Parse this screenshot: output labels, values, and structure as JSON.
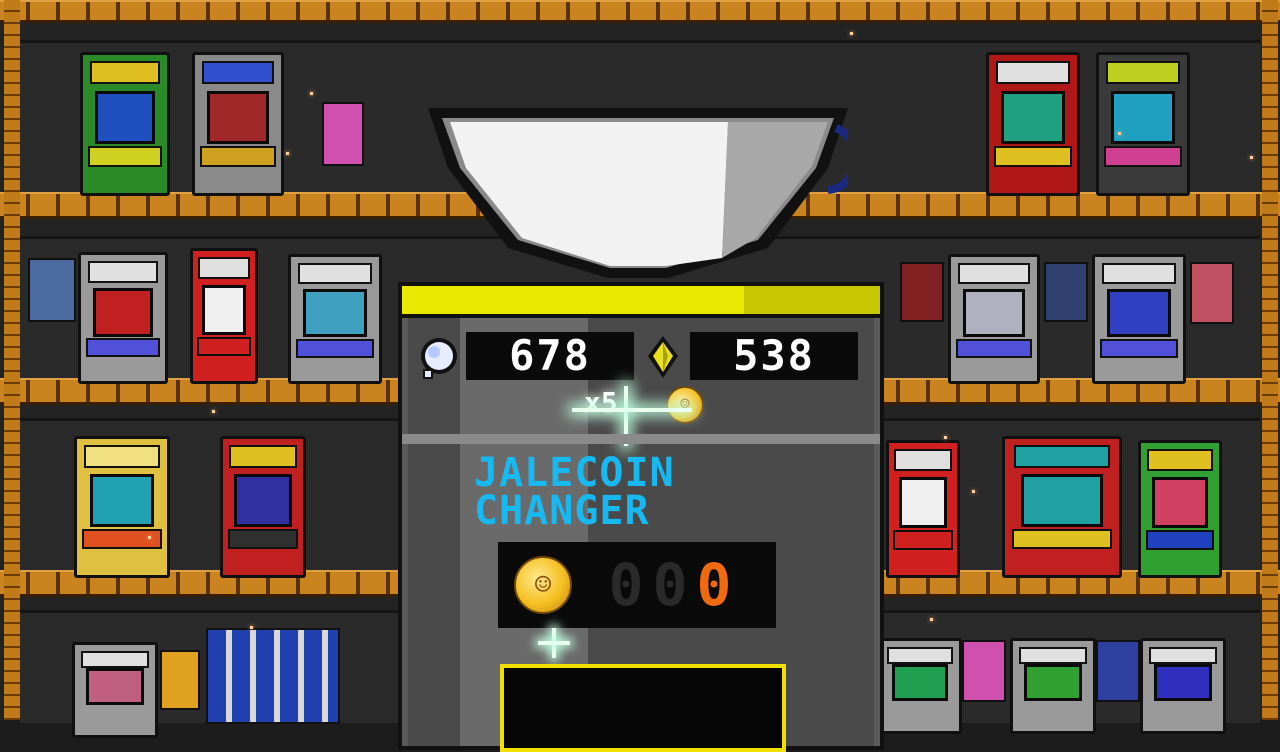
{
  "hud": {
    "tokens": "678",
    "gems": "538",
    "multiplier": "x5",
    "token_icon": "white-gem-icon",
    "gem_icon": "yellow-gem-icon",
    "coin_icon": "jalecoin-icon"
  },
  "changer": {
    "title_line1": "JALECOIN",
    "title_line2": "CHANGER",
    "digits": [
      "0",
      "0",
      "0"
    ],
    "digit_colors": [
      "#2a2a2a",
      "#2a2a2a",
      "#f06a10"
    ]
  },
  "colors": {
    "accent_yellow": "#e8e800",
    "title_cyan": "#18b8f0",
    "shelf_orange": "#c07a18"
  }
}
